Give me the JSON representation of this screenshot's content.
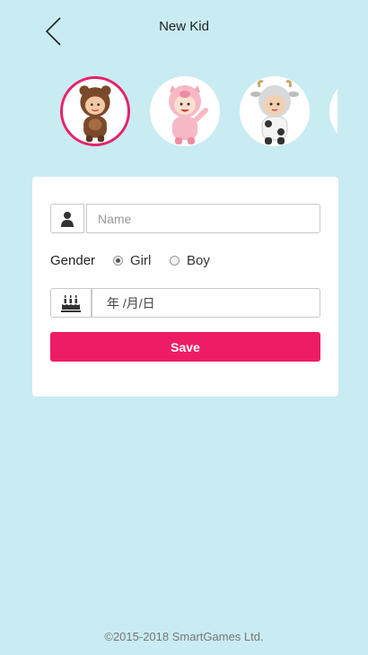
{
  "header": {
    "title": "New Kid",
    "back_icon": "chevron-left-icon"
  },
  "avatars": [
    {
      "name": "bear-costume-kid-avatar",
      "selected": true
    },
    {
      "name": "pig-costume-kid-avatar",
      "selected": false
    },
    {
      "name": "cow-costume-kid-avatar",
      "selected": false
    },
    {
      "name": "partial-kid-avatar",
      "selected": false
    }
  ],
  "form": {
    "name": {
      "placeholder": "Name",
      "value": "",
      "icon": "person-icon"
    },
    "gender": {
      "label": "Gender",
      "options": [
        {
          "label": "Girl",
          "checked": true
        },
        {
          "label": "Boy",
          "checked": false
        }
      ]
    },
    "birthday": {
      "value": "年 /月/日",
      "icon": "birthday-cake-icon"
    },
    "save_label": "Save"
  },
  "colors": {
    "background": "#c9ebf2",
    "accent": "#ee1c64",
    "selected_ring": "#e5226a"
  },
  "footer": {
    "copyright": "©2015-2018 SmartGames Ltd."
  }
}
